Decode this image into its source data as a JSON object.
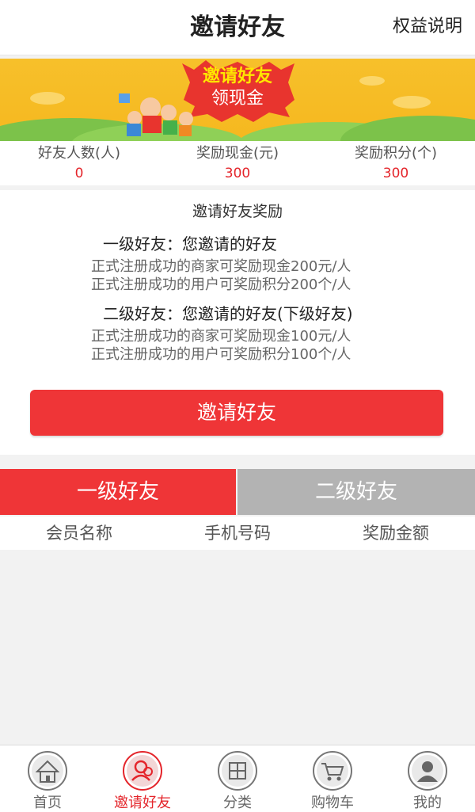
{
  "header": {
    "title": "邀请好友",
    "rules_link": "权益说明"
  },
  "banner": {
    "title": "邀请好友",
    "subtitle": "领现金"
  },
  "stats": [
    {
      "label": "好友人数(人)",
      "value": "0"
    },
    {
      "label": "奖励现金(元)",
      "value": "300"
    },
    {
      "label": "奖励积分(个)",
      "value": "300"
    }
  ],
  "rewards": {
    "heading": "邀请好友奖励",
    "level1": {
      "title": "一级好友：您邀请的好友",
      "line1": "正式注册成功的商家可奖励现金200元/人",
      "line2": "正式注册成功的用户可奖励积分200个/人"
    },
    "level2": {
      "title": "二级好友：您邀请的好友(下级好友)",
      "line1": "正式注册成功的商家可奖励现金100元/人",
      "line2": "正式注册成功的用户可奖励积分100个/人"
    }
  },
  "invite_button": "邀请好友",
  "tabs": [
    {
      "label": "一级好友",
      "active": true
    },
    {
      "label": "二级好友",
      "active": false
    }
  ],
  "columns": [
    "会员名称",
    "手机号码",
    "奖励金额"
  ],
  "nav": [
    {
      "label": "首页",
      "icon": "home-icon"
    },
    {
      "label": "邀请好友",
      "icon": "user-invite-icon",
      "active": true
    },
    {
      "label": "分类",
      "icon": "category-icon"
    },
    {
      "label": "购物车",
      "icon": "cart-icon"
    },
    {
      "label": "我的",
      "icon": "profile-icon"
    }
  ],
  "colors": {
    "accent": "#ef3537",
    "banner": "#f5b81f",
    "inactive_tab": "#b3b3b3"
  }
}
